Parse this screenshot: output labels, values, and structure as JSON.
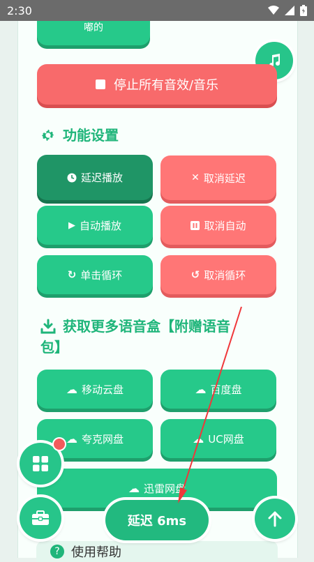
{
  "status_bar": {
    "time": "2:30"
  },
  "top_button": {
    "label": "嘟的"
  },
  "stop_all": {
    "label": "停止所有音效/音乐"
  },
  "function_settings": {
    "title": "功能设置",
    "buttons": [
      {
        "label": "延迟播放",
        "icon": "clock-icon"
      },
      {
        "label": "取消延迟",
        "icon": "x-icon"
      },
      {
        "label": "自动播放",
        "icon": "play-icon"
      },
      {
        "label": "取消自动",
        "icon": "pause-icon"
      },
      {
        "label": "单击循环",
        "icon": "redo-icon"
      },
      {
        "label": "取消循环",
        "icon": "undo-icon"
      }
    ]
  },
  "more_voice": {
    "title_line1": "获取更多语音盒【附赠语音",
    "title_line2": "包】",
    "buttons": [
      {
        "label": "移动云盘",
        "icon": "cloud-icon"
      },
      {
        "label": "百度盘",
        "icon": "cloud-icon"
      },
      {
        "label": "夸克网盘",
        "icon": "cloud-icon"
      },
      {
        "label": "UC网盘",
        "icon": "cloud-icon"
      },
      {
        "label": "迅雷网盘",
        "icon": "cloud-icon"
      }
    ]
  },
  "delay_pill": {
    "label": "延迟 6ms"
  },
  "help": {
    "title": "使用帮助"
  },
  "colors": {
    "green": "#26c98a",
    "red": "#f86a6b",
    "title_green": "#1fb57a"
  }
}
